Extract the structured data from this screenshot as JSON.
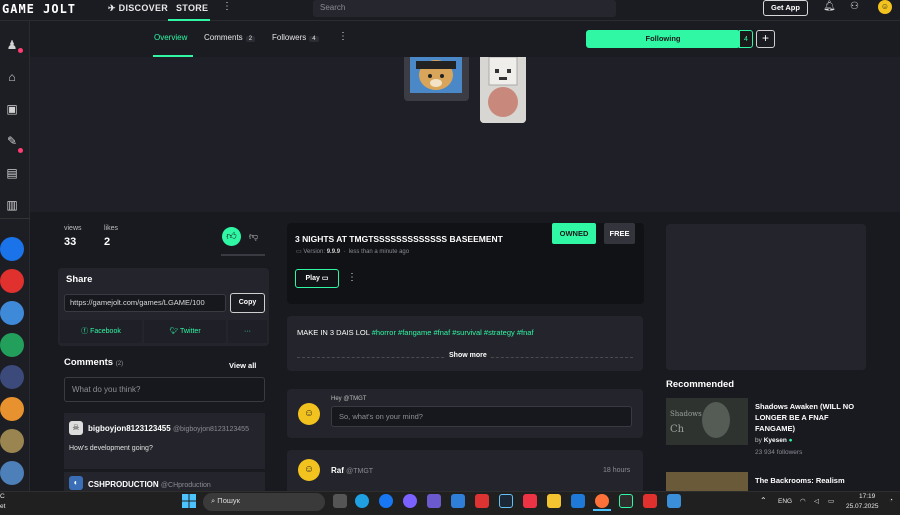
{
  "topbar": {
    "logo": "GAME JOLT",
    "nav": {
      "discover": "DISCOVER",
      "store": "STORE"
    },
    "search_placeholder": "Search",
    "get_app": "Get App"
  },
  "subnav": {
    "tabs": [
      {
        "label": "Overview",
        "count": ""
      },
      {
        "label": "Comments",
        "count": "2"
      },
      {
        "label": "Followers",
        "count": "4"
      }
    ],
    "following_label": "Following",
    "following_count": "4",
    "plus": "+"
  },
  "stats": {
    "views_label": "views",
    "views_value": "33",
    "likes_label": "likes",
    "likes_value": "2"
  },
  "share": {
    "title": "Share",
    "url": "https://gamejolt.com/games/LGAME/100",
    "copy_label": "Copy",
    "facebook": "Facebook",
    "twitter": "Twitter",
    "more": "···"
  },
  "comments": {
    "title": "Comments",
    "count": "(2)",
    "view_all": "View all",
    "placeholder": "What do you think?",
    "items": [
      {
        "user": "bigboyjon8123123455",
        "handle": "@bigboyjon8123123455",
        "text": "How's development going?"
      },
      {
        "user": "CSHPRODUCTION",
        "handle": "@CHproduction",
        "text": ""
      }
    ]
  },
  "game": {
    "owned": "OWNED",
    "free": "FREE",
    "title": "3 NIGHTS AT TMGTSSSSSSSSSSSSS BASEEMENT",
    "version_label": "Version:",
    "version": "9.9.9",
    "updated": "less than a minute ago",
    "play": "Play"
  },
  "description": {
    "text": "MAKE IN 3 DAIS LOL",
    "tags": "#horror #fangame #fnaf #survival #strategy #fnaf",
    "show_more": "Show more"
  },
  "post": {
    "hey": "Hey @TMGT",
    "placeholder": "So, what's on your mind?"
  },
  "feed": {
    "user": "Raf",
    "handle": "@TMGT",
    "time": "18 hours"
  },
  "recommended": {
    "title": "Recommended",
    "items": [
      {
        "title": "Shadows Awaken (WILL NO LONGER BE A FNAF FANGAME)",
        "by_label": "by",
        "author": "Kyesen",
        "followers": "23 934 followers"
      },
      {
        "title": "The Backrooms: Realism",
        "by_label": "",
        "author": "",
        "followers": ""
      }
    ]
  },
  "taskbar": {
    "search": "Пошук",
    "lang": "ENG",
    "time": "17:19",
    "date": "25.07.2025",
    "left_a": "C",
    "left_b": "et"
  },
  "colors": {
    "accent": "#2ff7a4",
    "notification": "#ff3d71"
  }
}
